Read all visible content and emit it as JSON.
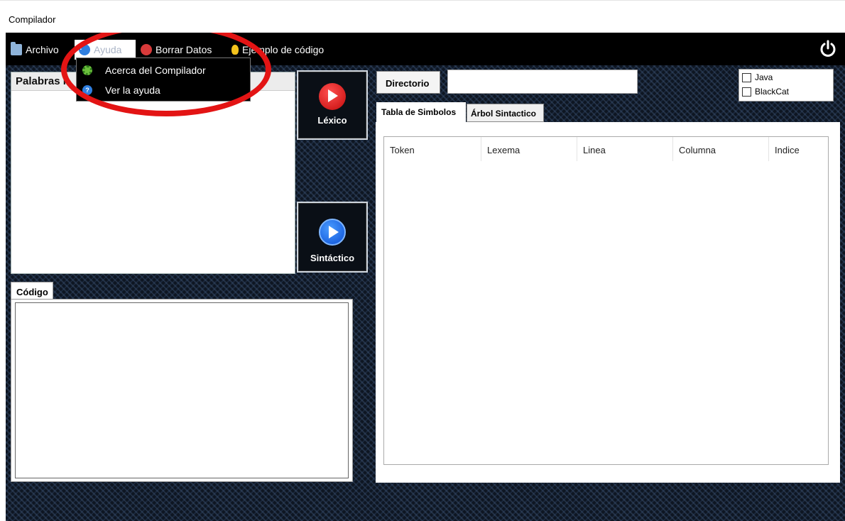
{
  "window": {
    "title": "Compilador"
  },
  "menu": {
    "archivo": "Archivo",
    "ayuda": "Ayuda",
    "borrar": "Borrar Datos",
    "ejemplo": "Ejemplo de código"
  },
  "ayuda_menu": {
    "items": [
      "Acerca del Compilador",
      "Ver la ayuda"
    ]
  },
  "palabras": {
    "title": "Palabras r"
  },
  "buttons": {
    "lexico": "Léxico",
    "sintactico": "Sintáctico"
  },
  "codigo": {
    "tab_label": "Código"
  },
  "directorio": {
    "label": "Directorio",
    "value": ""
  },
  "languages": {
    "java": "Java",
    "blackcat": "BlackCat"
  },
  "tabs": {
    "simbolos": "Tabla de Simbolos",
    "arbol": "Árbol Sintactico"
  },
  "table": {
    "columns": [
      "Token",
      "Lexema",
      "Linea",
      "Columna",
      "Indice"
    ],
    "rows": []
  },
  "colors": {
    "annotation": "#e31414",
    "background": "#0e1622"
  }
}
